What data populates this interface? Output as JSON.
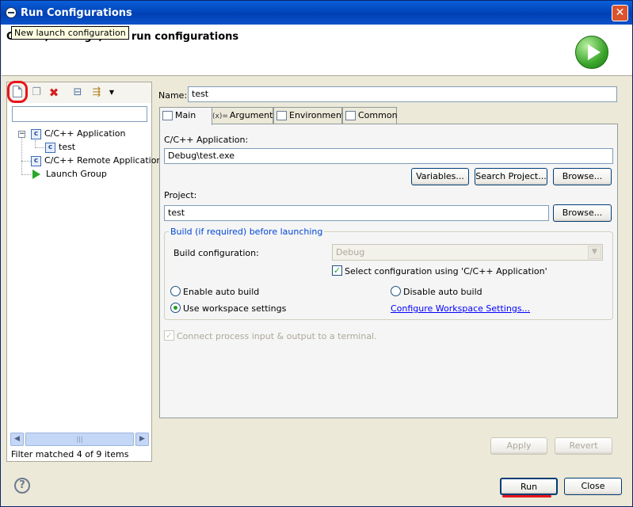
{
  "window": {
    "title": "Run Configurations",
    "close_glyph": "✕"
  },
  "banner": {
    "title": "Create, manage, and run configurations"
  },
  "left": {
    "tooltip": "New launch configuration",
    "tree": [
      {
        "label": "C/C++ Application",
        "icon": "c-icon"
      },
      {
        "label": "test",
        "icon": "c-icon"
      },
      {
        "label": "C/C++ Remote Application",
        "icon": "c-icon"
      },
      {
        "label": "Launch Group",
        "icon": "launch-icon"
      }
    ],
    "status": "Filter matched 4 of 9 items"
  },
  "name": {
    "label": "Name:",
    "value": "test"
  },
  "tabs": [
    {
      "label": "Main"
    },
    {
      "label": "Arguments",
      "icon_text": "(x)="
    },
    {
      "label": "Environment"
    },
    {
      "label": "Common"
    }
  ],
  "main": {
    "app_label": "C/C++ Application:",
    "app_value": "Debug\\test.exe",
    "variables_btn": "Variables...",
    "search_btn": "Search Project...",
    "browse_btn": "Browse...",
    "project_label": "Project:",
    "project_value": "test",
    "project_browse_btn": "Browse...",
    "build_group_title": "Build (if required) before launching",
    "build_config_label": "Build configuration:",
    "build_config_value": "Debug",
    "select_config_label": "Select configuration using 'C/C++ Application'",
    "enable_auto_build": "Enable auto build",
    "disable_auto_build": "Disable auto build",
    "use_workspace": "Use workspace settings",
    "configure_link": "Configure Workspace Settings...",
    "connect_label": "Connect process input & output to a terminal."
  },
  "buttons": {
    "apply": "Apply",
    "revert": "Revert",
    "run": "Run",
    "close": "Close"
  }
}
